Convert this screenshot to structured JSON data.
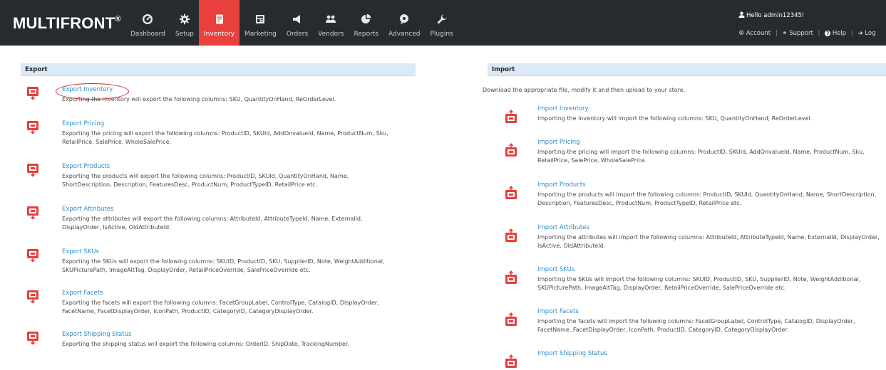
{
  "brand": {
    "name": "MULTIFRONT",
    "mark": "®"
  },
  "nav": [
    {
      "label": "Dashboard",
      "icon": "dashboard-icon",
      "active": false
    },
    {
      "label": "Setup",
      "icon": "gear-icon",
      "active": false
    },
    {
      "label": "Inventory",
      "icon": "inventory-icon",
      "active": true
    },
    {
      "label": "Marketing",
      "icon": "marketing-icon",
      "active": false
    },
    {
      "label": "Orders",
      "icon": "megaphone-icon",
      "active": false
    },
    {
      "label": "Vendors",
      "icon": "users-icon",
      "active": false
    },
    {
      "label": "Reports",
      "icon": "pie-chart-icon",
      "active": false
    },
    {
      "label": "Advanced",
      "icon": "advanced-icon",
      "active": false
    },
    {
      "label": "Plugins",
      "icon": "wrench-icon",
      "active": false
    }
  ],
  "user": {
    "greeting": "Hello admin12345!",
    "account": "Account",
    "support": "Support",
    "help": "Help",
    "logout": "Log"
  },
  "colors": {
    "topbar": "#272b30",
    "active": "#e8403c",
    "link": "#2e8bc8",
    "panel_header": "#dce9f7",
    "icon": "#e8403c"
  },
  "export": {
    "heading": "Export",
    "items": [
      {
        "title": "Export Inventory",
        "desc": "Exporting the inventory will export the following columns: SKU, QuantityOnHand, ReOrderLevel."
      },
      {
        "title": "Export Pricing",
        "desc": "Exporting the pricing will export the following columns: ProductID, SKUId, AddOnvalueId, Name, ProductNum, Sku, RetailPrice, SalePrice, WholeSalePrice."
      },
      {
        "title": "Export Products",
        "desc": "Exporting the products will export the following columns: ProductID, SKUId, QuantityOnHand, Name, ShortDescription, Description, FeaturesDesc, ProductNum, ProductTypeID, RetailPrice etc."
      },
      {
        "title": "Export Attributes",
        "desc": "Exporting the attributes will export the following columns: AttributeId, AttributeTypeId, Name, ExternalId, DisplayOrder, IsActive, OldAttributeId."
      },
      {
        "title": "Export SKUs",
        "desc": "Exporting the SKUs will export the following columns: SKUID, ProductID, SKU, SupplierID, Note, WeightAdditional, SKUPicturePath, ImageAltTag, DisplayOrder, RetailPriceOverride, SalePriceOverride etc."
      },
      {
        "title": "Export Facets",
        "desc": "Exporting the facets will export the following columns: FacetGroupLabel, ControlType, CatalogID, DisplayOrder, FacetName, FacetDisplayOrder, IconPath, ProductID, CategoryID, CategoryDisplayOrder."
      },
      {
        "title": "Export Shipping Status",
        "desc": "Exporting the shipping status will export the following columns: OrderID, ShipDate, TrackingNumber."
      }
    ]
  },
  "import": {
    "heading": "Import",
    "intro": "Download the appropriate file, modify it and then upload to your store.",
    "items": [
      {
        "title": "Import Inventory",
        "desc": "Importing the inventory will import the following columns: SKU, QuantityOnHand, ReOrderLevel."
      },
      {
        "title": "Import Pricing",
        "desc": "Importing the pricing will import the following columns: ProductID, SKUId, AddOnvalueId, Name, ProductNum, Sku, RetailPrice, SalePrice, WholeSalePrice."
      },
      {
        "title": "Import Products",
        "desc": "Importing the products will import the following columns: ProductID, SKUId, QuantityOnHand, Name, ShortDescription, Description, FeaturesDesc, ProductNum, ProductTypeID, RetailPrice etc."
      },
      {
        "title": "Import Attributes",
        "desc": "Importing the attributes will import the following columns: AttributeId, AttributeTypeId, Name, ExternalId, DisplayOrder, IsActive, OldAttributeId."
      },
      {
        "title": "Import SKUs",
        "desc": "Importing the SKUs will import the following columns: SKUID, ProductID, SKU, SupplierID, Note, WeightAdditional, SKUPicturePath, ImageAltTag, DisplayOrder, RetailPriceOverride, SalePriceOverride etc."
      },
      {
        "title": "Import Facets",
        "desc": "Importing the facets will import the following columns: FacetGroupLabel, ControlType, CatalogID, DisplayOrder, FacetName, FacetDisplayOrder, IconPath, ProductID, CategoryID, CategoryDisplayOrder."
      },
      {
        "title": "Import Shipping Status",
        "desc": ""
      }
    ]
  }
}
